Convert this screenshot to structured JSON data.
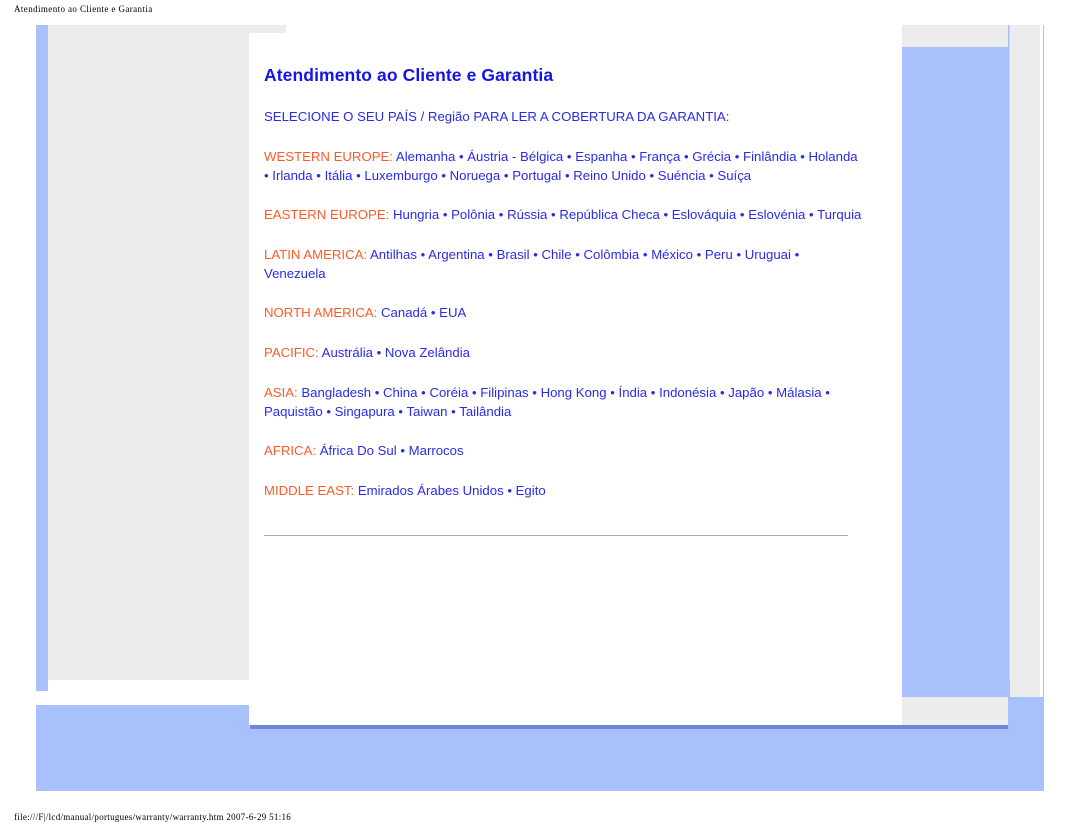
{
  "browser": {
    "header_title": "Atendimento ao Cliente e Garantia",
    "footer_path": "file:///F|/lcd/manual/portugues/warranty/warranty.htm 2007-6-29 51:16"
  },
  "colors": {
    "title_blue": "#1414e6",
    "link_blue": "#2a2ae8",
    "region_orange": "#ff5a28",
    "page_blue": "#a8c0fb",
    "panel_grey": "#ececec"
  },
  "document": {
    "title": "Atendimento ao Cliente e Garantia",
    "lead": "SELECIONE O SEU PAÍS / Região PARA LER A COBERTURA DA GARANTIA:",
    "separator": "•",
    "regions": [
      {
        "name": "WESTERN EUROPE:",
        "countries": [
          "Alemanha",
          "Áustria - Bélgica",
          "Espanha",
          "França",
          "Grécia",
          "Finlândia",
          "Holanda",
          "Irlanda",
          "Itália",
          "Luxemburgo",
          "Noruega",
          "Portugal",
          "Reino Unido",
          "Suéncia",
          "Suíça"
        ]
      },
      {
        "name": "EASTERN EUROPE:",
        "countries": [
          "Hungria",
          "Polônia",
          "Rússia",
          "República Checa",
          "Eslováquia",
          "Eslovénia",
          "Turquia"
        ]
      },
      {
        "name": "LATIN AMERICA:",
        "countries": [
          "Antilhas",
          "Argentina",
          "Brasil",
          "Chile",
          "Colômbia",
          "México",
          "Peru",
          "Uruguai",
          "Venezuela"
        ]
      },
      {
        "name": "NORTH AMERICA:",
        "countries": [
          "Canadá",
          "EUA"
        ]
      },
      {
        "name": "PACIFIC:",
        "countries": [
          "Austrália",
          "Nova Zelândia"
        ]
      },
      {
        "name": "ASIA:",
        "countries": [
          "Bangladesh",
          "China",
          "Coréia",
          "Filipinas",
          "Hong Kong",
          "Índia",
          "Indonésia",
          "Japão",
          "Málasia",
          "Paquistão",
          "Singapura",
          "Taiwan",
          "Tailândia"
        ]
      },
      {
        "name": "AFRICA:",
        "countries": [
          "África Do Sul",
          "Marrocos"
        ]
      },
      {
        "name": "MIDDLE EAST:",
        "countries": [
          "Emirados Árabes Unidos",
          "Egito"
        ]
      }
    ]
  }
}
